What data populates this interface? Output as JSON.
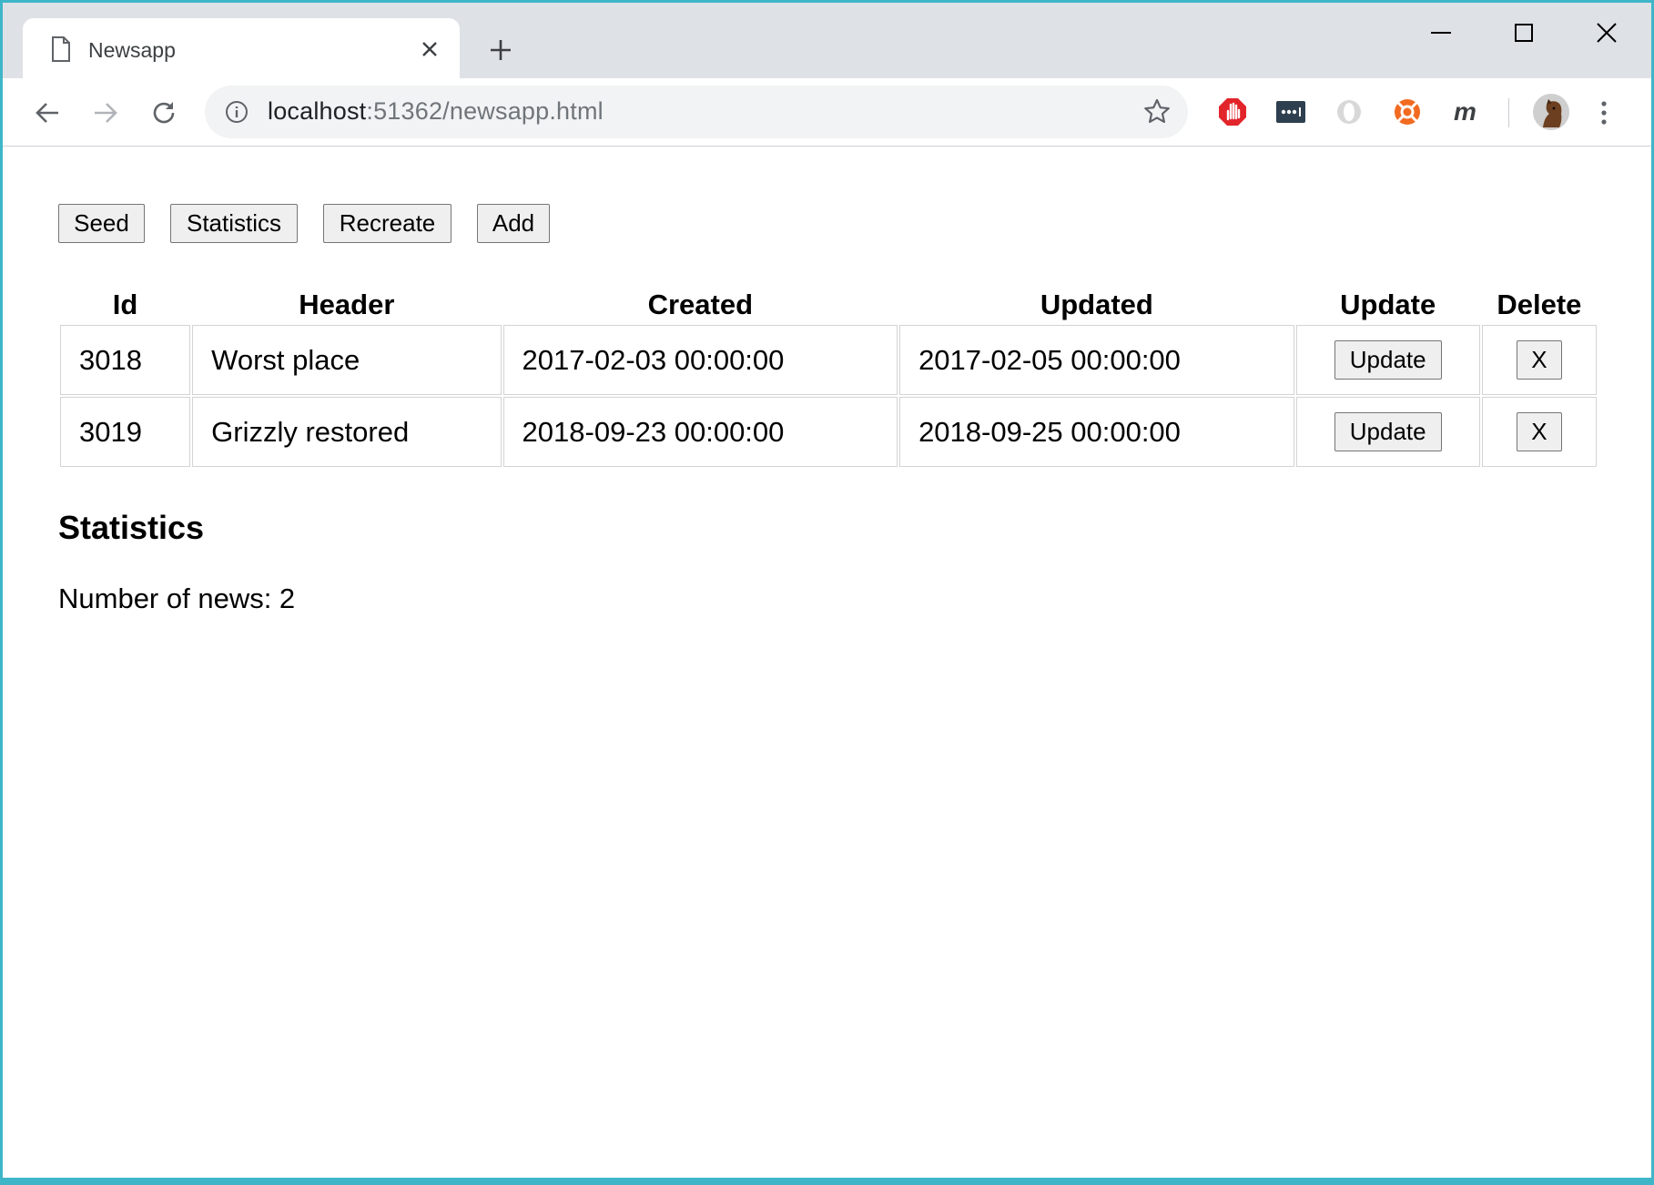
{
  "browser": {
    "tab_title": "Newsapp",
    "url_host": "localhost",
    "url_rest": ":51362/newsapp.html"
  },
  "actions": {
    "seed": "Seed",
    "statistics": "Statistics",
    "recreate": "Recreate",
    "add": "Add"
  },
  "table": {
    "columns": [
      "Id",
      "Header",
      "Created",
      "Updated",
      "Update",
      "Delete"
    ],
    "rows": [
      {
        "id": "3018",
        "header": "Worst place",
        "created": "2017-02-03 00:00:00",
        "updated": "2017-02-05 00:00:00",
        "update_label": "Update",
        "delete_label": "X"
      },
      {
        "id": "3019",
        "header": "Grizzly restored",
        "created": "2018-09-23 00:00:00",
        "updated": "2018-09-25 00:00:00",
        "update_label": "Update",
        "delete_label": "X"
      }
    ]
  },
  "statistics": {
    "title": "Statistics",
    "count_text": "Number of news: 2"
  },
  "colors": {
    "frame": "#3fb6c8",
    "tabstrip": "#dee1e6",
    "omnibox": "#f1f3f4",
    "button_bg": "#efefef"
  },
  "icons": [
    "document-icon",
    "close-tab-icon",
    "new-tab-icon",
    "minimize-icon",
    "maximize-icon",
    "close-window-icon",
    "back-icon",
    "forward-icon",
    "reload-icon",
    "info-icon",
    "bookmark-star-icon",
    "adblock-extension-icon",
    "password-extension-icon",
    "opera-extension-icon",
    "help-extension-icon",
    "m-extension-icon",
    "profile-avatar",
    "menu-icon"
  ]
}
